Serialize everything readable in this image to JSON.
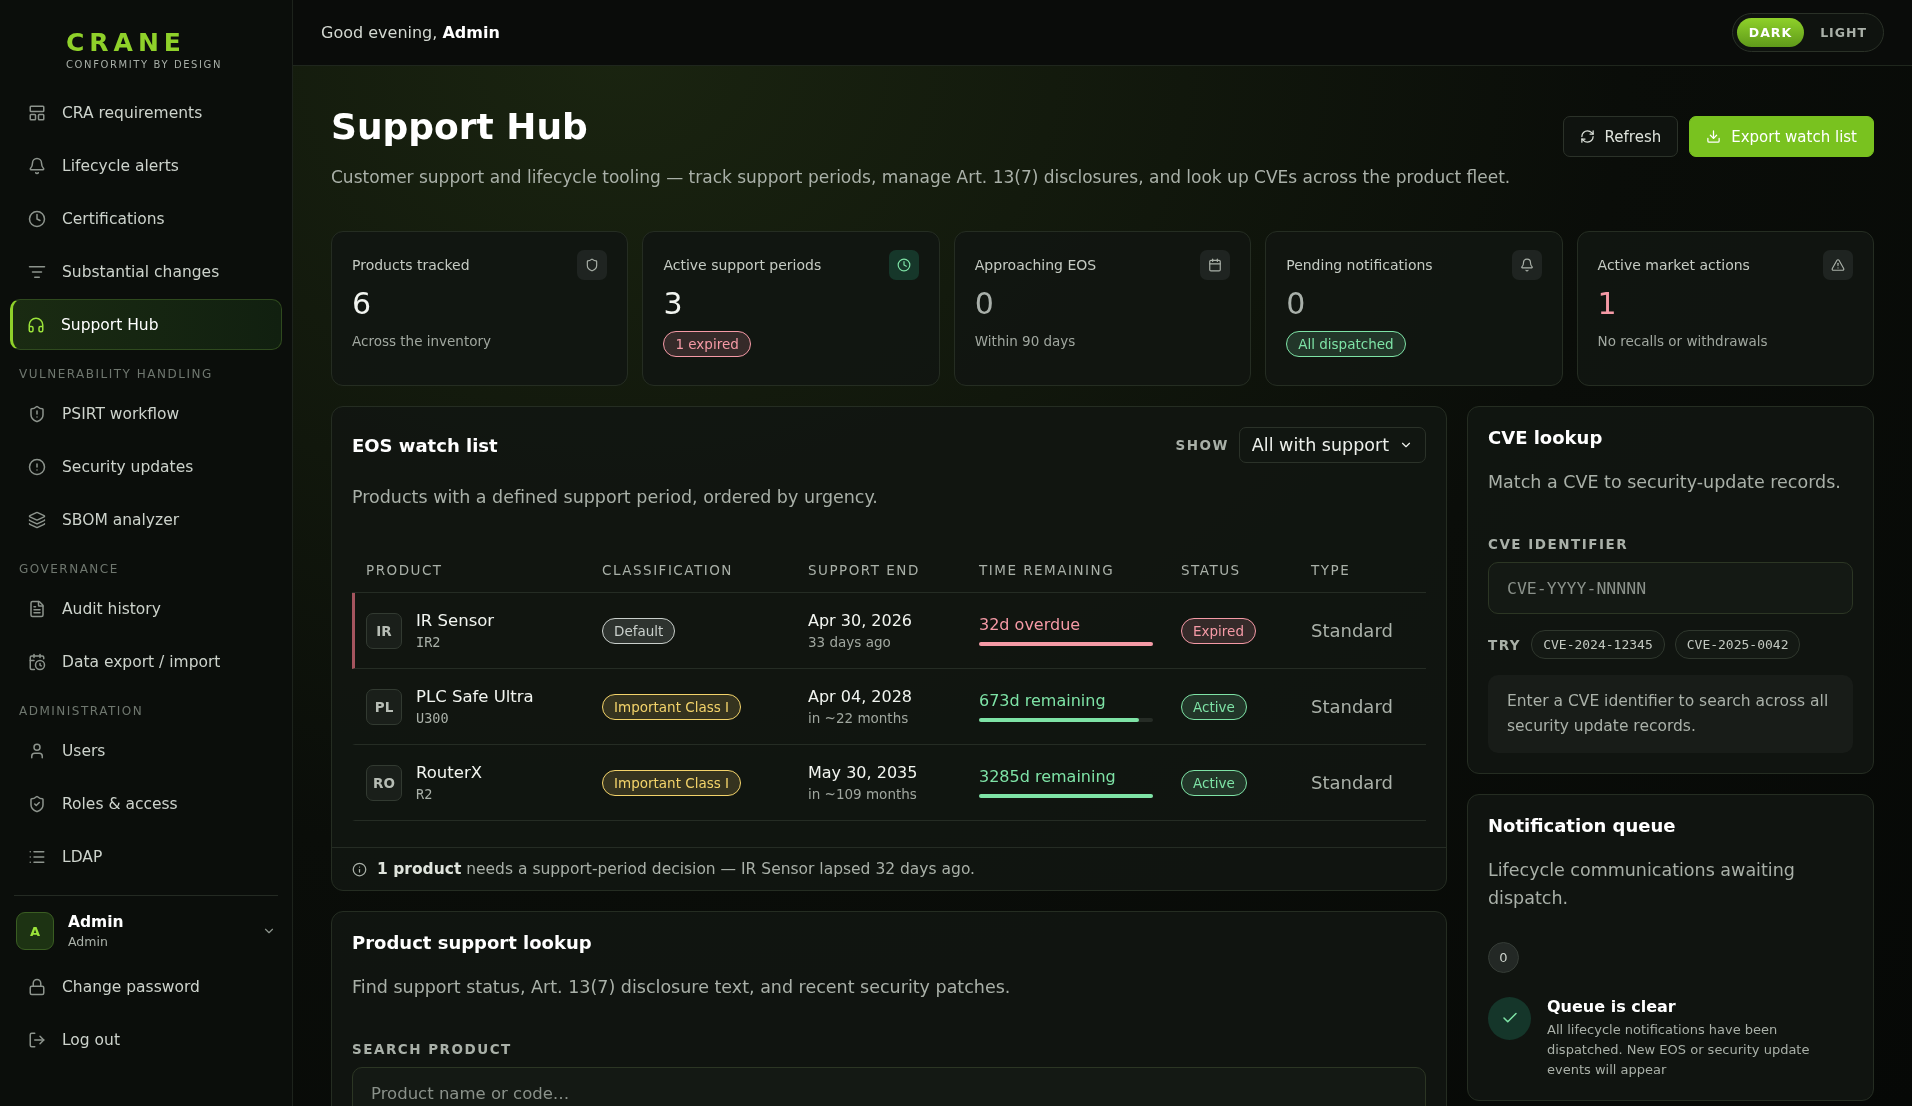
{
  "brand": {
    "name": "CRANE",
    "tagline": "CONFORMITY BY DESIGN"
  },
  "sidebar": {
    "sections": [
      {
        "items": [
          {
            "label": "CRA requirements",
            "selected": false
          },
          {
            "label": "Lifecycle alerts",
            "selected": false
          },
          {
            "label": "Certifications",
            "selected": false
          },
          {
            "label": "Substantial changes",
            "selected": false
          },
          {
            "label": "Support Hub",
            "selected": true
          }
        ]
      },
      {
        "heading": "VULNERABILITY HANDLING",
        "items": [
          {
            "label": "PSIRT workflow",
            "selected": false
          },
          {
            "label": "Security updates",
            "selected": false
          },
          {
            "label": "SBOM analyzer",
            "selected": false
          }
        ]
      },
      {
        "heading": "GOVERNANCE",
        "items": [
          {
            "label": "Audit history",
            "selected": false
          },
          {
            "label": "Data export / import",
            "selected": false
          }
        ]
      },
      {
        "heading": "ADMINISTRATION",
        "items": [
          {
            "label": "Users",
            "selected": false
          },
          {
            "label": "Roles & access",
            "selected": false
          },
          {
            "label": "LDAP",
            "selected": false
          }
        ]
      }
    ],
    "user": {
      "initial": "A",
      "name": "Admin",
      "role": "Admin"
    },
    "footer_items": [
      {
        "label": "Change password"
      },
      {
        "label": "Log out"
      }
    ]
  },
  "header": {
    "greeting": "Good evening, **Admin**",
    "theme_options": [
      {
        "label": "DARK",
        "selected": true
      },
      {
        "label": "LIGHT",
        "selected": false
      }
    ]
  },
  "page": {
    "title": "Support Hub",
    "subtitle": "Customer support and lifecycle tooling — track support periods, manage Art. 13(7) disclosures, and look up CVEs across the product fleet.",
    "buttons": [
      {
        "label": "Refresh",
        "kind": "secondary"
      },
      {
        "label": "Export watch list",
        "kind": "primary"
      }
    ]
  },
  "stats": [
    {
      "label": "Products tracked",
      "value": "6",
      "color": "#f2f5f0",
      "highlighted": false,
      "sub": {
        "kind": "text",
        "text": "Across the inventory"
      }
    },
    {
      "label": "Active support periods",
      "value": "3",
      "color": "#f2f5f0",
      "highlighted": true,
      "sub": {
        "kind": "badge",
        "text": "1 expired",
        "color": "#f59aa6"
      }
    },
    {
      "label": "Approaching EOS",
      "value": "0",
      "color": "#a9b0aa",
      "highlighted": false,
      "sub": {
        "kind": "text",
        "text": "Within 90 days"
      }
    },
    {
      "label": "Pending notifications",
      "value": "0",
      "color": "#a9b0aa",
      "highlighted": false,
      "sub": {
        "kind": "badge",
        "text": "All dispatched",
        "color": "#7ee3a6"
      }
    },
    {
      "label": "Active market actions",
      "value": "1",
      "color": "#f59aa6",
      "highlighted": false,
      "sub": {
        "kind": "text",
        "text": "No recalls or withdrawals"
      }
    }
  ],
  "watch_list": {
    "title": "EOS watch list",
    "subtitle": "Products with a defined support period, ordered by urgency.",
    "filter_label": "SHOW",
    "filter_value": "All with support",
    "columns": [
      "PRODUCT",
      "CLASSIFICATION",
      "SUPPORT END",
      "TIME REMAINING",
      "STATUS",
      "TYPE"
    ],
    "rows": [
      {
        "initials": "IR",
        "name": "IR Sensor",
        "code": "IR2",
        "flagged": true,
        "classification": {
          "label": "Default",
          "color": "#c9cfcb"
        },
        "support_end": "Apr 30, 2026",
        "relative": "33 days ago",
        "remaining": "32d overdue",
        "level": 1,
        "color": "#f59aa6",
        "status": {
          "label": "Expired",
          "color": "#f59aa6"
        },
        "type": "Standard"
      },
      {
        "initials": "PL",
        "name": "PLC Safe Ultra",
        "code": "U300",
        "flagged": false,
        "classification": {
          "label": "Important Class I",
          "color": "#f3d36a"
        },
        "support_end": "Apr 04, 2028",
        "relative": "in ~22 months",
        "remaining": "673d remaining",
        "level": 0.92,
        "color": "#7ee3a6",
        "status": {
          "label": "Active",
          "color": "#7ee3a6"
        },
        "type": "Standard"
      },
      {
        "initials": "RO",
        "name": "RouterX",
        "code": "R2",
        "flagged": false,
        "classification": {
          "label": "Important Class I",
          "color": "#f3d36a"
        },
        "support_end": "May 30, 2035",
        "relative": "in ~109 months",
        "remaining": "3285d remaining",
        "level": 1,
        "color": "#7ee3a6",
        "status": {
          "label": "Active",
          "color": "#7ee3a6"
        },
        "type": "Standard"
      }
    ],
    "footer": "**1 product** needs a support-period decision — IR Sensor lapsed 32 days ago."
  },
  "product_lookup": {
    "title": "Product support lookup",
    "subtitle": "Find support status, Art. 13(7) disclosure text, and recent security patches.",
    "field_label": "SEARCH PRODUCT",
    "placeholder": "Product name or code…"
  },
  "cve_lookup": {
    "title": "CVE lookup",
    "subtitle": "Match a CVE to security-update records.",
    "field_label": "CVE IDENTIFIER",
    "placeholder": "CVE-YYYY-NNNNN",
    "try_label": "TRY",
    "examples": [
      "CVE-2024-12345",
      "CVE-2025-0042"
    ],
    "hint": "Enter a CVE identifier to search across all security update records."
  },
  "notification_queue": {
    "title": "Notification queue",
    "subtitle": "Lifecycle communications awaiting dispatch.",
    "count": "0",
    "empty_title": "Queue is clear",
    "empty_text": "All lifecycle notifications have been dispatched. New EOS or security update events will appear"
  }
}
